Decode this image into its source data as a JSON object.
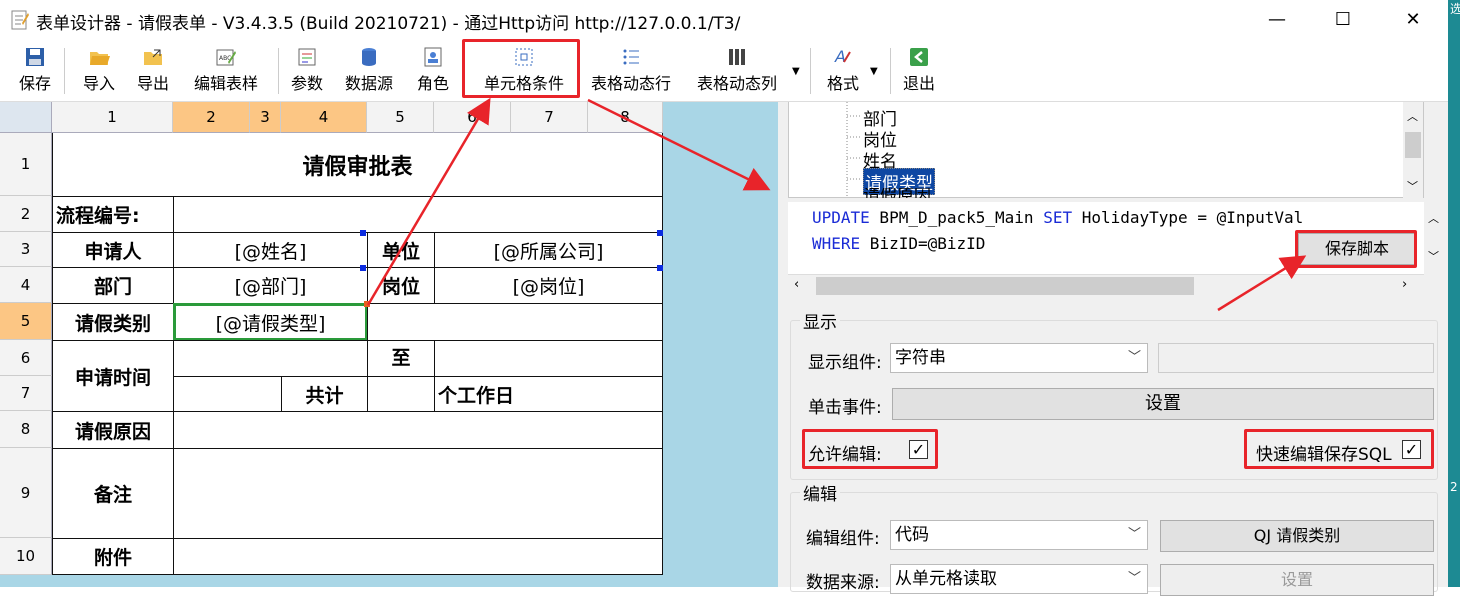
{
  "window": {
    "title": "表单设计器 - 请假表单 - V3.4.3.5 (Build 20210721) - 通过Http访问 http://127.0.0.1/T3/",
    "minimize": "—",
    "maximize": "☐",
    "close": "✕"
  },
  "toolbar": {
    "save": "保存",
    "import": "导入",
    "export": "导出",
    "edit_template": "编辑表样",
    "params": "参数",
    "datasource": "数据源",
    "role": "角色",
    "cell_condition": "单元格条件",
    "dyn_row": "表格动态行",
    "dyn_col": "表格动态列",
    "format": "格式",
    "exit": "退出"
  },
  "sheet": {
    "col_headers": [
      "1",
      "2",
      "3",
      "4",
      "5",
      "6",
      "7",
      "8"
    ],
    "row_headers": [
      "1",
      "2",
      "3",
      "4",
      "5",
      "6",
      "7",
      "8",
      "9",
      "10"
    ],
    "title": "请假审批表",
    "flow_no": "流程编号:",
    "applicant": "申请人",
    "name_field": "[@姓名]",
    "unit": "单位",
    "company_field": "[@所属公司]",
    "dept": "部门",
    "dept_field": "[@部门]",
    "post": "岗位",
    "post_field": "[@岗位]",
    "leave_type": "请假类别",
    "leave_type_field": "[@请假类型]",
    "to": "至",
    "apply_time": "申请时间",
    "total": "共计",
    "workdays": "个工作日",
    "reason": "请假原因",
    "remark": "备注",
    "attach": "附件"
  },
  "tree": {
    "items": [
      "部门",
      "岗位",
      "姓名",
      "请假类型",
      "请假原因"
    ]
  },
  "code": {
    "line1_kw1": "UPDATE",
    "line1_mid": " BPM_D_pack5_Main ",
    "line1_kw2": "SET",
    "line1_rest": " HolidayType = @InputVal",
    "line2_kw": "WHERE",
    "line2_rest": " BizID=@BizID",
    "save_script": "保存脚本"
  },
  "display": {
    "section": "显示",
    "component_label": "显示组件:",
    "component_value": "字符串",
    "click_label": "单击事件:",
    "click_btn": "设置",
    "allow_edit": "允许编辑:",
    "quick_save": "快速编辑保存SQL"
  },
  "edit": {
    "section": "编辑",
    "component_label": "编辑组件:",
    "component_value": "代码",
    "qj_btn": "QJ 请假类别",
    "source_label": "数据来源:",
    "source_value": "从单元格读取",
    "setup_btn": "设置"
  },
  "colors": {
    "highlight": "#e8242a",
    "selected_header": "#fcc684",
    "canvas": "#a9d6e6",
    "keyword": "#1a2bd6"
  },
  "desktop": {
    "glyph1": "选",
    "glyph2": "2"
  }
}
